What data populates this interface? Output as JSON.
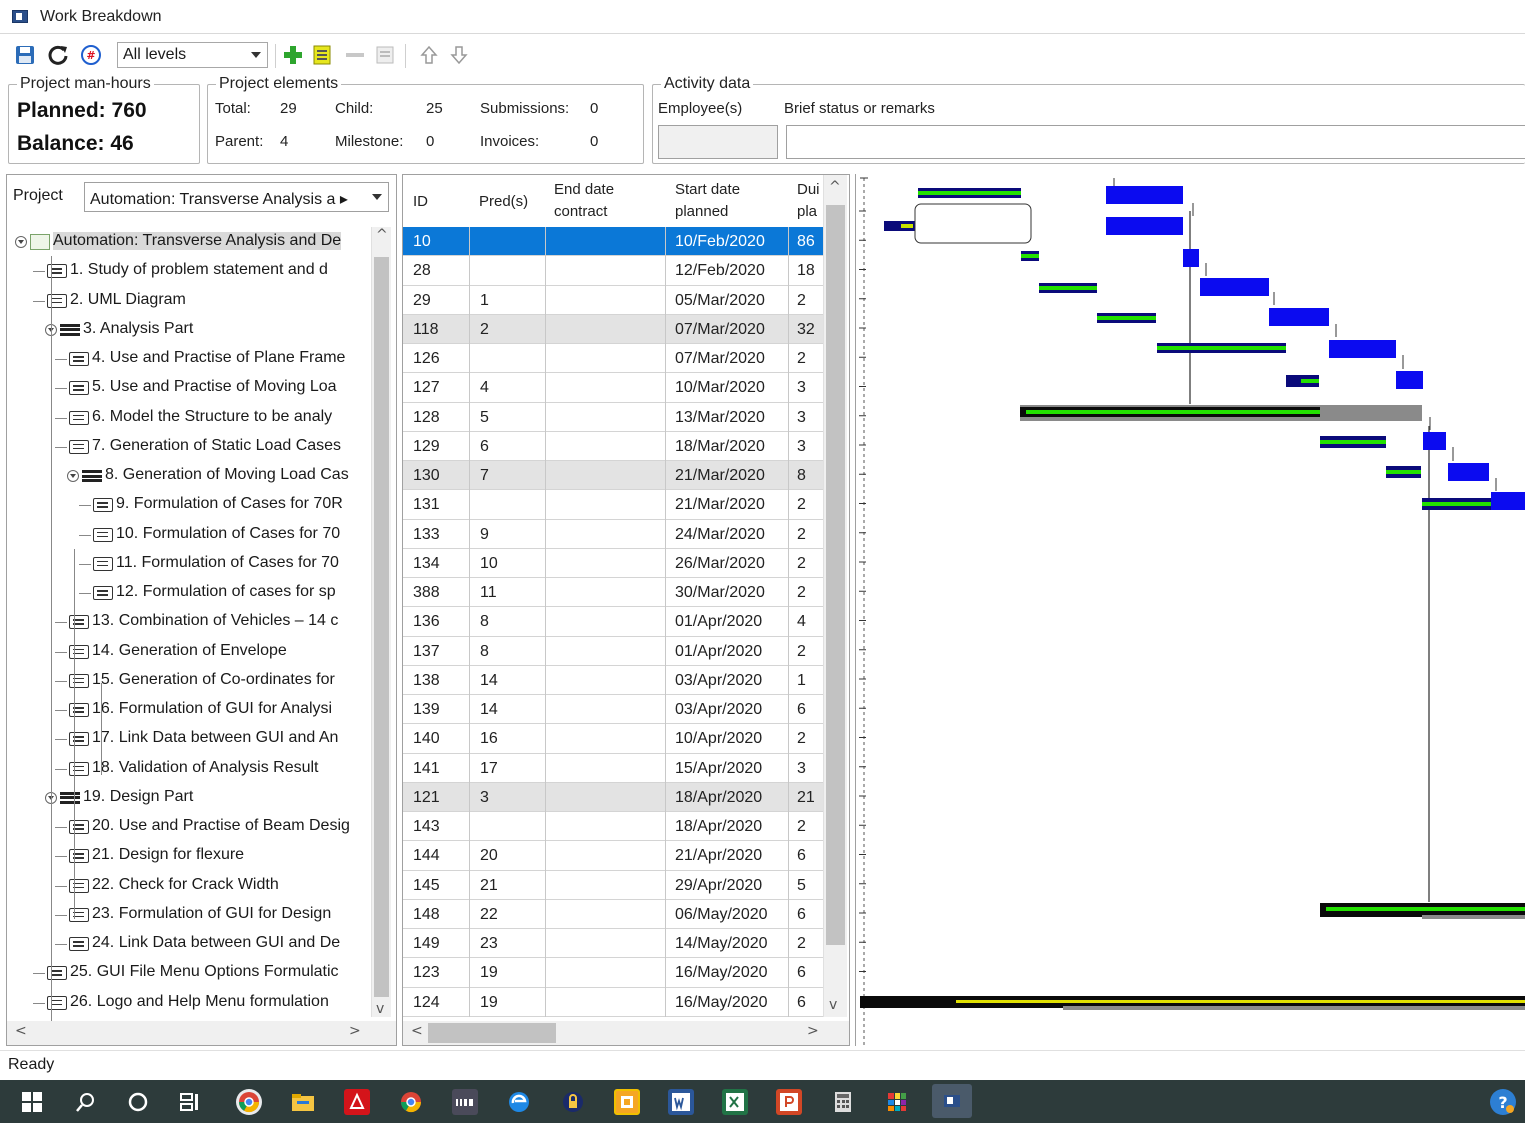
{
  "window": {
    "title": "Work Breakdown"
  },
  "toolbar": {
    "level_filter": "All levels",
    "icons": [
      "save-icon",
      "refresh-icon",
      "renumber-icon",
      "add-child-icon",
      "add-task-icon",
      "remove-icon",
      "outdent-icon",
      "move-up-icon",
      "move-down-icon"
    ]
  },
  "man_hours": {
    "group_label": "Project man-hours",
    "planned": "Planned: 760",
    "balance": "Balance: 46"
  },
  "elements": {
    "group_label": "Project elements",
    "total_label": "Total:",
    "total": "29",
    "child_label": "Child:",
    "child": "25",
    "submissions_label": "Submissions:",
    "submissions": "0",
    "parent_label": "Parent:",
    "parent": "4",
    "milestone_label": "Milestone:",
    "milestone": "0",
    "invoices_label": "Invoices:",
    "invoices": "0"
  },
  "activity": {
    "group_label": "Activity data",
    "employees_label": "Employee(s)",
    "remarks_label": "Brief status or remarks"
  },
  "project": {
    "label": "Project",
    "value": "Automation: Transverse Analysis a ▸"
  },
  "tree": [
    {
      "text": "Automation: Transverse Analysis and De",
      "kind": "root",
      "level": 0
    },
    {
      "text": "1. Study of problem statement and d",
      "kind": "task",
      "level": 1
    },
    {
      "text": "2. UML Diagram",
      "kind": "task",
      "level": 1
    },
    {
      "text": "3. Analysis Part",
      "kind": "summary",
      "level": 1
    },
    {
      "text": "4. Use and Practise of Plane Frame",
      "kind": "task",
      "level": 2
    },
    {
      "text": "5. Use and Practise of Moving Loa",
      "kind": "task",
      "level": 2
    },
    {
      "text": "6. Model the Structure to be analy",
      "kind": "task",
      "level": 2
    },
    {
      "text": "7. Generation of Static Load Cases",
      "kind": "task",
      "level": 2
    },
    {
      "text": "8. Generation of Moving Load Cas",
      "kind": "summary",
      "level": 2
    },
    {
      "text": "9. Formulation of Cases for 70R",
      "kind": "task",
      "level": 3
    },
    {
      "text": "10. Formulation of Cases for 70",
      "kind": "task",
      "level": 3
    },
    {
      "text": "11. Formulation of Cases for 70",
      "kind": "task",
      "level": 3
    },
    {
      "text": "12. Formulation of cases for sp",
      "kind": "task",
      "level": 3
    },
    {
      "text": "13. Combination of Vehicles – 14 c",
      "kind": "task",
      "level": 2
    },
    {
      "text": "14. Generation of Envelope",
      "kind": "task",
      "level": 2
    },
    {
      "text": "15. Generation of Co-ordinates for",
      "kind": "task",
      "level": 2
    },
    {
      "text": "16. Formulation of GUI for Analysi",
      "kind": "task",
      "level": 2
    },
    {
      "text": "17. Link Data between GUI and An",
      "kind": "task",
      "level": 2
    },
    {
      "text": "18. Validation of Analysis Result",
      "kind": "task",
      "level": 2
    },
    {
      "text": "19. Design Part",
      "kind": "summary",
      "level": 1
    },
    {
      "text": "20. Use and Practise of Beam Desig",
      "kind": "task",
      "level": 2
    },
    {
      "text": "21. Design for flexure",
      "kind": "task",
      "level": 2
    },
    {
      "text": "22. Check for Crack Width",
      "kind": "task",
      "level": 2
    },
    {
      "text": "23. Formulation of GUI for Design",
      "kind": "task",
      "level": 2
    },
    {
      "text": "24. Link Data between GUI and De",
      "kind": "task",
      "level": 2
    },
    {
      "text": "25. GUI File Menu Options Formulatic",
      "kind": "task",
      "level": 1
    },
    {
      "text": "26. Logo and Help Menu formulation",
      "kind": "task",
      "level": 1
    }
  ],
  "grid": {
    "headers": {
      "id": "ID",
      "pred": "Pred(s)",
      "end1": "End date",
      "end2": "contract",
      "start1": "Start date",
      "start2": "planned",
      "dur1": "Dui",
      "dur2": "pla"
    },
    "rows": [
      {
        "id": "10",
        "pred": "",
        "start": "10/Feb/2020",
        "dur": "86",
        "kind": "selected"
      },
      {
        "id": "28",
        "pred": "",
        "start": "12/Feb/2020",
        "dur": "18",
        "kind": "task"
      },
      {
        "id": "29",
        "pred": "1",
        "start": "05/Mar/2020",
        "dur": "2",
        "kind": "task"
      },
      {
        "id": "118",
        "pred": "2",
        "start": "07/Mar/2020",
        "dur": "32",
        "kind": "summary"
      },
      {
        "id": "126",
        "pred": "",
        "start": "07/Mar/2020",
        "dur": "2",
        "kind": "task"
      },
      {
        "id": "127",
        "pred": "4",
        "start": "10/Mar/2020",
        "dur": "3",
        "kind": "task"
      },
      {
        "id": "128",
        "pred": "5",
        "start": "13/Mar/2020",
        "dur": "3",
        "kind": "task"
      },
      {
        "id": "129",
        "pred": "6",
        "start": "18/Mar/2020",
        "dur": "3",
        "kind": "task"
      },
      {
        "id": "130",
        "pred": "7",
        "start": "21/Mar/2020",
        "dur": "8",
        "kind": "summary"
      },
      {
        "id": "131",
        "pred": "",
        "start": "21/Mar/2020",
        "dur": "2",
        "kind": "task"
      },
      {
        "id": "133",
        "pred": "9",
        "start": "24/Mar/2020",
        "dur": "2",
        "kind": "task"
      },
      {
        "id": "134",
        "pred": "10",
        "start": "26/Mar/2020",
        "dur": "2",
        "kind": "task"
      },
      {
        "id": "388",
        "pred": "11",
        "start": "30/Mar/2020",
        "dur": "2",
        "kind": "task"
      },
      {
        "id": "136",
        "pred": "8",
        "start": "01/Apr/2020",
        "dur": "4",
        "kind": "task"
      },
      {
        "id": "137",
        "pred": "8",
        "start": "01/Apr/2020",
        "dur": "2",
        "kind": "task"
      },
      {
        "id": "138",
        "pred": "14",
        "start": "03/Apr/2020",
        "dur": "1",
        "kind": "task"
      },
      {
        "id": "139",
        "pred": "14",
        "start": "03/Apr/2020",
        "dur": "6",
        "kind": "task"
      },
      {
        "id": "140",
        "pred": "16",
        "start": "10/Apr/2020",
        "dur": "2",
        "kind": "task"
      },
      {
        "id": "141",
        "pred": "17",
        "start": "15/Apr/2020",
        "dur": "3",
        "kind": "task"
      },
      {
        "id": "121",
        "pred": "3",
        "start": "18/Apr/2020",
        "dur": "21",
        "kind": "summary"
      },
      {
        "id": "143",
        "pred": "",
        "start": "18/Apr/2020",
        "dur": "2",
        "kind": "task"
      },
      {
        "id": "144",
        "pred": "20",
        "start": "21/Apr/2020",
        "dur": "6",
        "kind": "task"
      },
      {
        "id": "145",
        "pred": "21",
        "start": "29/Apr/2020",
        "dur": "5",
        "kind": "task"
      },
      {
        "id": "148",
        "pred": "22",
        "start": "06/May/2020",
        "dur": "6",
        "kind": "task"
      },
      {
        "id": "149",
        "pred": "23",
        "start": "14/May/2020",
        "dur": "2",
        "kind": "task"
      },
      {
        "id": "123",
        "pred": "19",
        "start": "16/May/2020",
        "dur": "6",
        "kind": "task"
      },
      {
        "id": "124",
        "pred": "19",
        "start": "16/May/2020",
        "dur": "6",
        "kind": "task"
      }
    ]
  },
  "status": {
    "text": "Ready"
  },
  "taskbar": {
    "items": [
      "start-button",
      "search-icon",
      "cortana-icon",
      "task-view-icon",
      "chrome-icon",
      "file-explorer-icon",
      "acrobat-icon",
      "chrome-alt-icon",
      "live-icon",
      "edge-icon",
      "lock-app-icon",
      "outlook-icon",
      "word-icon",
      "excel-icon",
      "powerpoint-icon",
      "calculator-icon",
      "colorful-app-icon",
      "work-breakdown-app-icon",
      "help-icon"
    ]
  }
}
